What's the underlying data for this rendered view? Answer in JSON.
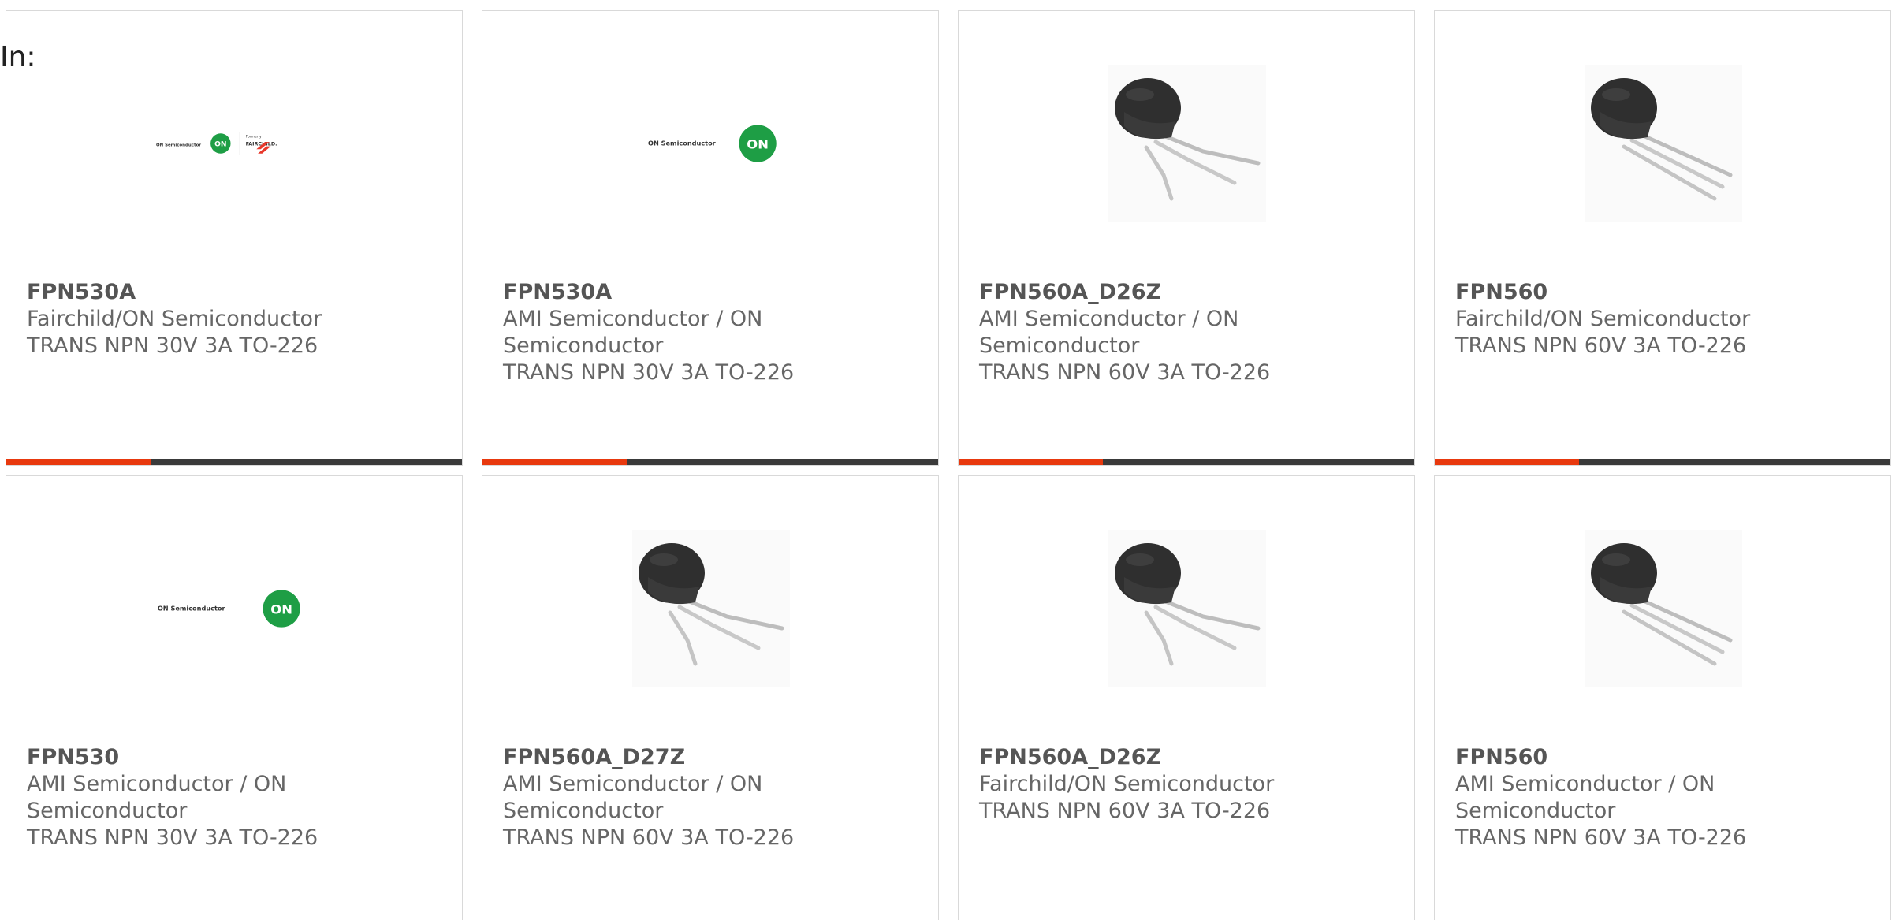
{
  "filter": {
    "label": "In:"
  },
  "colors": {
    "accent_orange": "#e8390e",
    "accent_dark": "#3a3a3a",
    "on_green": "#1e9e45",
    "fairchild_red": "#e8372a"
  },
  "cards": [
    {
      "part_number": "FPN530A",
      "manufacturer": "Fairchild/ON Semiconductor",
      "description": "TRANS NPN 30V 3A TO-226",
      "image": "on-fairchild-logo",
      "logo_text": "ON Semiconductor",
      "logo_sub": "Formerly",
      "logo_brand": "FAIRCHILD."
    },
    {
      "part_number": "FPN530A",
      "manufacturer": "AMI Semiconductor / ON Semiconductor",
      "description": "TRANS NPN 30V 3A TO-226",
      "image": "on-semiconductor-logo",
      "logo_text": "ON Semiconductor"
    },
    {
      "part_number": "FPN560A_D26Z",
      "manufacturer": "AMI Semiconductor / ON Semiconductor",
      "description": "TRANS NPN 60V 3A TO-226",
      "image": "to-226-bent-leads"
    },
    {
      "part_number": "FPN560",
      "manufacturer": "Fairchild/ON Semiconductor",
      "description": "TRANS NPN 60V 3A TO-226",
      "image": "to-226-straight-leads"
    },
    {
      "part_number": "FPN530",
      "manufacturer": "AMI Semiconductor / ON Semiconductor",
      "description": "TRANS NPN 30V 3A TO-226",
      "image": "on-semiconductor-logo",
      "logo_text": "ON Semiconductor"
    },
    {
      "part_number": "FPN560A_D27Z",
      "manufacturer": "AMI Semiconductor / ON Semiconductor",
      "description": "TRANS NPN 60V 3A TO-226",
      "image": "to-226-bent-leads"
    },
    {
      "part_number": "FPN560A_D26Z",
      "manufacturer": "Fairchild/ON Semiconductor",
      "description": "TRANS NPN 60V 3A TO-226",
      "image": "to-226-bent-leads"
    },
    {
      "part_number": "FPN560",
      "manufacturer": "AMI Semiconductor / ON Semiconductor",
      "description": "TRANS NPN 60V 3A TO-226",
      "image": "to-226-straight-leads"
    }
  ]
}
